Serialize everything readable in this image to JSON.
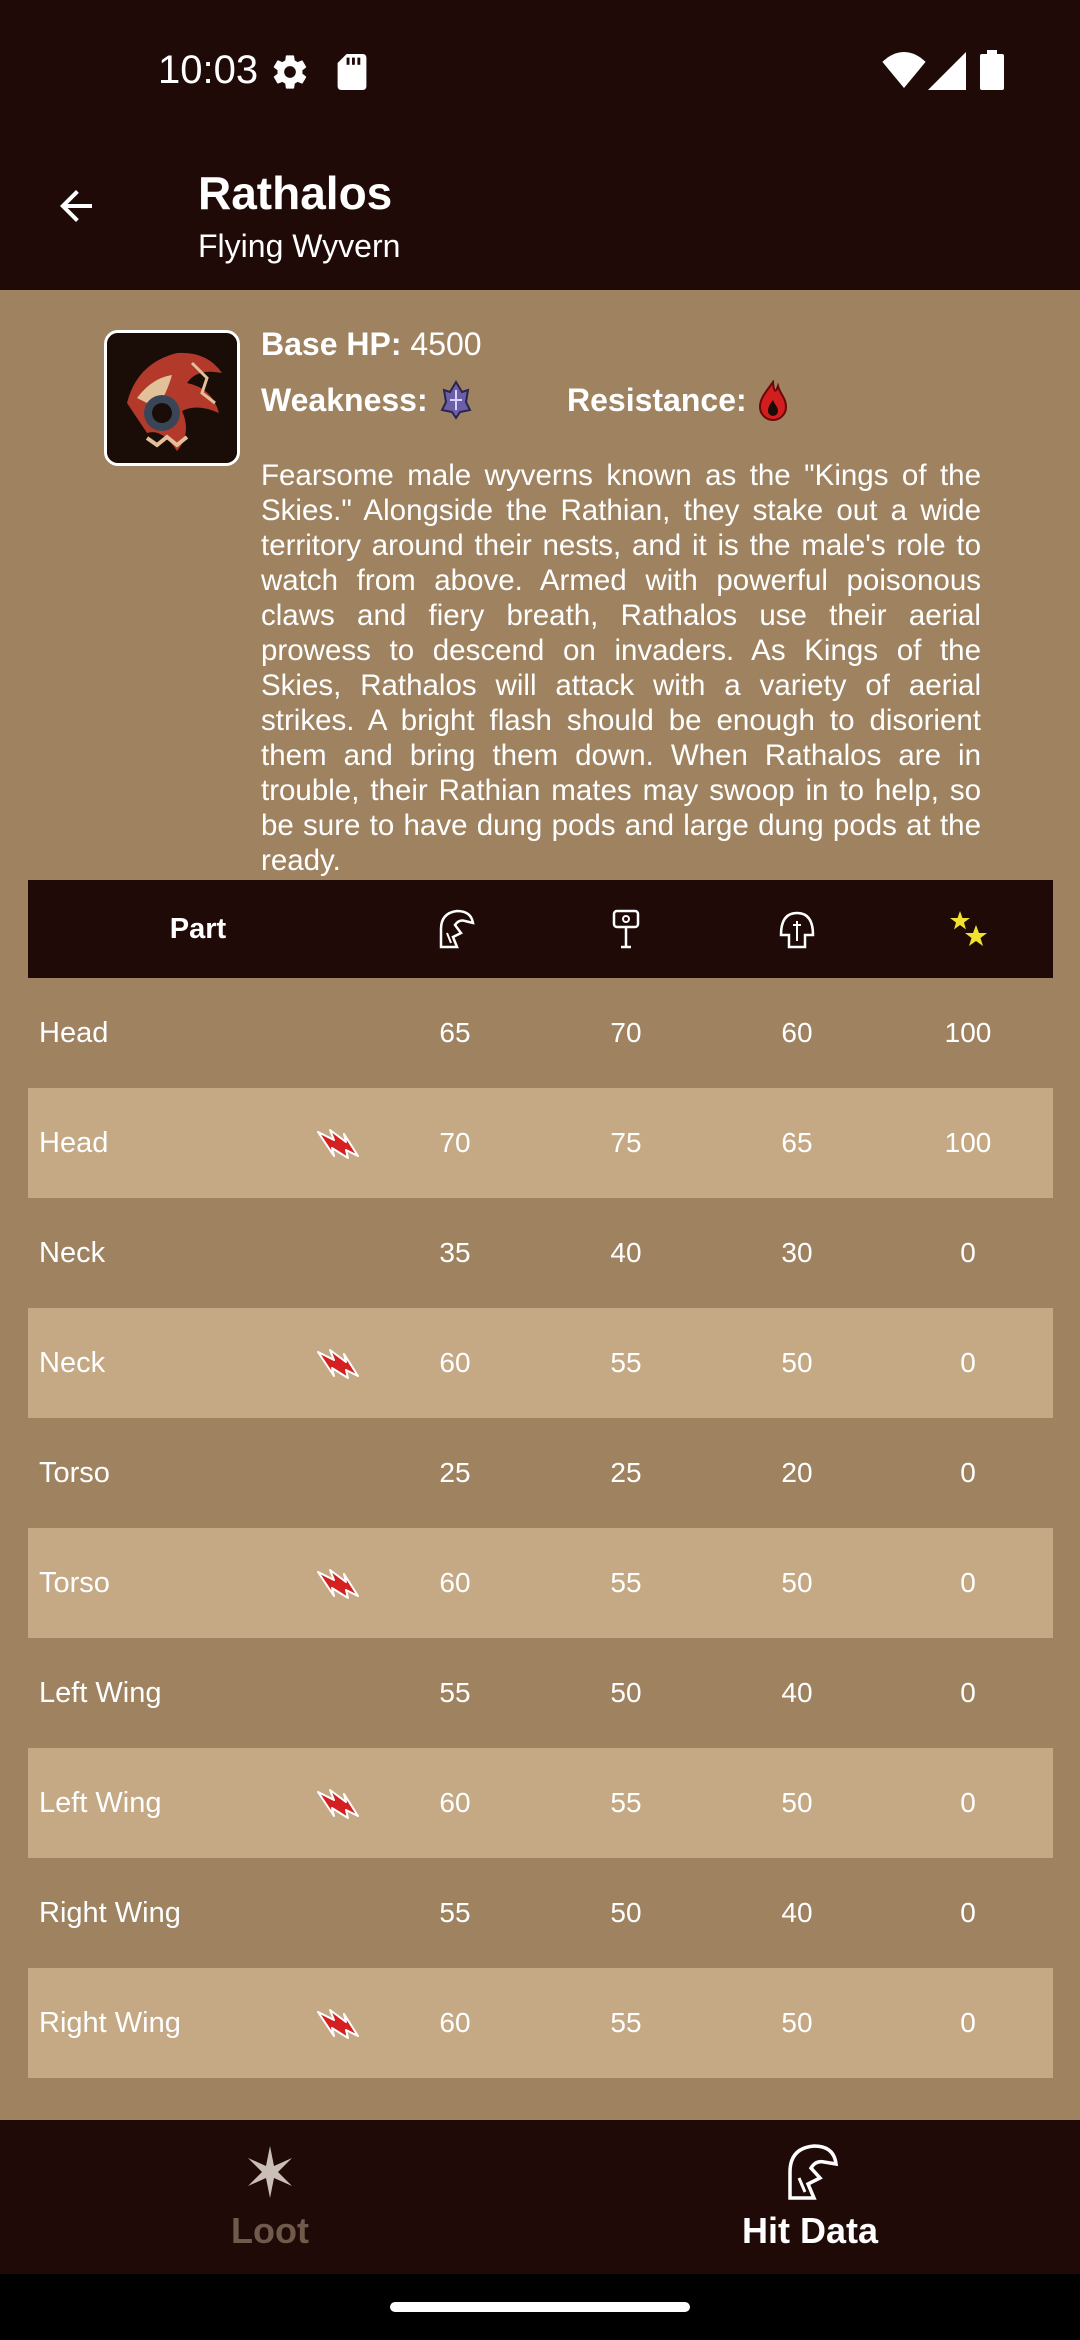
{
  "status": {
    "time": "10:03"
  },
  "app_bar": {
    "title": "Rathalos",
    "subtitle": "Flying Wyvern"
  },
  "info": {
    "hp_label": "Base HP:",
    "hp_value": "4500",
    "weakness_label": "Weakness:",
    "weakness_icon": "dragon-element-icon",
    "resistance_label": "Resistance:",
    "resistance_icon": "fire-element-icon",
    "description": "Fearsome male wyverns known as the \"Kings of the Skies.\" Alongside the Rathian, they stake out a wide territory around their nests, and it is the male's role to watch from above. Armed with powerful poisonous claws and fiery breath, Rathalos use their aerial prowess to descend on invaders. As Kings of the Skies, Rathalos will attack with a variety of aerial strikes. A bright flash should be enough to disorient them and bring them down. When Rathalos are in trouble, their Rathian mates may swoop in to help, so be sure to have dung pods and large dung pods at the ready."
  },
  "table": {
    "header_part": "Part",
    "header_icons": [
      "sever-helmet-icon",
      "blunt-hammer-icon",
      "shot-helmet-icon",
      "stun-star-icon"
    ],
    "rows": [
      {
        "part": "Head",
        "broken": false,
        "cut": "65",
        "blunt": "70",
        "shot": "60",
        "stun": "100"
      },
      {
        "part": "Head",
        "broken": true,
        "cut": "70",
        "blunt": "75",
        "shot": "65",
        "stun": "100"
      },
      {
        "part": "Neck",
        "broken": false,
        "cut": "35",
        "blunt": "40",
        "shot": "30",
        "stun": "0"
      },
      {
        "part": "Neck",
        "broken": true,
        "cut": "60",
        "blunt": "55",
        "shot": "50",
        "stun": "0"
      },
      {
        "part": "Torso",
        "broken": false,
        "cut": "25",
        "blunt": "25",
        "shot": "20",
        "stun": "0"
      },
      {
        "part": "Torso",
        "broken": true,
        "cut": "60",
        "blunt": "55",
        "shot": "50",
        "stun": "0"
      },
      {
        "part": "Left Wing",
        "broken": false,
        "cut": "55",
        "blunt": "50",
        "shot": "40",
        "stun": "0"
      },
      {
        "part": "Left Wing",
        "broken": true,
        "cut": "60",
        "blunt": "55",
        "shot": "50",
        "stun": "0"
      },
      {
        "part": "Right Wing",
        "broken": false,
        "cut": "55",
        "blunt": "50",
        "shot": "40",
        "stun": "0"
      },
      {
        "part": "Right Wing",
        "broken": true,
        "cut": "60",
        "blunt": "55",
        "shot": "50",
        "stun": "0"
      }
    ]
  },
  "nav": {
    "loot_label": "Loot",
    "hit_label": "Hit Data",
    "active": "hit"
  },
  "colors": {
    "bar": "#200a07",
    "body": "#9f8361",
    "row_alt": "#c4a984",
    "inactive_nav": "#6f5a4c",
    "break_icon": "#d42020"
  }
}
